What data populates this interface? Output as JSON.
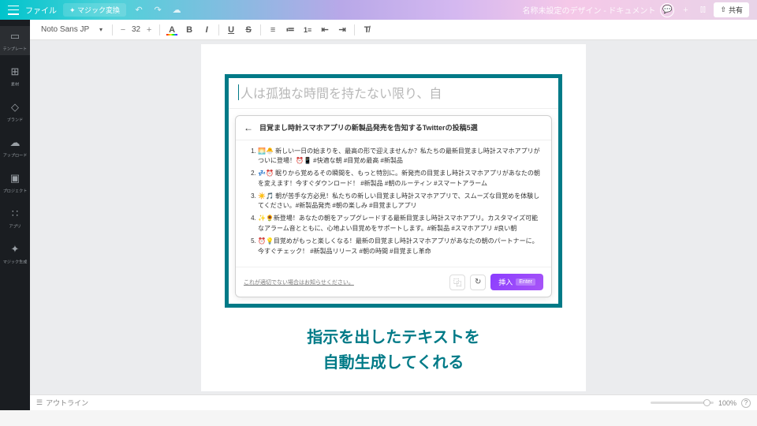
{
  "topbar": {
    "file_label": "ファイル",
    "magic_label": "マジック変換",
    "doc_title": "名称未設定のデザイン - ドキュメント",
    "share_label": "共有"
  },
  "sidebar": {
    "items": [
      {
        "label": "テンプレート",
        "icon": "▭"
      },
      {
        "label": "素材",
        "icon": "⊞"
      },
      {
        "label": "ブランド",
        "icon": "◇"
      },
      {
        "label": "アップロード",
        "icon": "☁"
      },
      {
        "label": "プロジェクト",
        "icon": "▣"
      },
      {
        "label": "アプリ",
        "icon": "∷"
      },
      {
        "label": "マジック生成",
        "icon": "✦"
      }
    ]
  },
  "toolbar": {
    "font_name": "Noto Sans JP",
    "font_size": "32",
    "minus": "−",
    "plus": "+"
  },
  "ai": {
    "placeholder": "人は孤独な時間を持たない限り、自",
    "title": "目覚まし時計スマホアプリの新製品発売を告知するTwitterの投稿5選",
    "items": [
      "🌅🐣 新しい一日の始まりを、最高の形で迎えませんか？私たちの最新目覚まし時計スマホアプリがついに登場！⏰📱 #快適な朝 #目覚め最高 #新製品",
      "💤⏰ 眠りから覚めるその瞬間を、もっと特別に。新発売の目覚まし時計スマホアプリがあなたの朝を変えます！今すぐダウンロード！ #新製品 #朝のルーティン #スマートアラーム",
      "☀️🎵 朝が苦手な方必見！私たちの新しい目覚まし時計スマホアプリで、スムーズな目覚めを体験してください。#新製品発売 #朝の楽しみ #目覚ましアプリ",
      "✨🌻新登場！あなたの朝をアップグレードする最新目覚まし時計スマホアプリ。カスタマイズ可能なアラーム音とともに、心地よい目覚めをサポートします。#新製品 #スマホアプリ #良い朝",
      "⏰💡目覚めがもっと楽しくなる！最新の目覚まし時計スマホアプリがあなたの朝のパートナーに。今すぐチェック！ #新製品リリース #朝の時間 #目覚まし革命"
    ],
    "feedback": "これが適切でない場合はお知らせください。",
    "insert_label": "挿入",
    "enter_label": "Enter"
  },
  "caption": {
    "line1": "指示を出したテキストを",
    "line2": "自動生成してくれる"
  },
  "bottom": {
    "outline": "アウトライン",
    "zoom": "100%"
  }
}
